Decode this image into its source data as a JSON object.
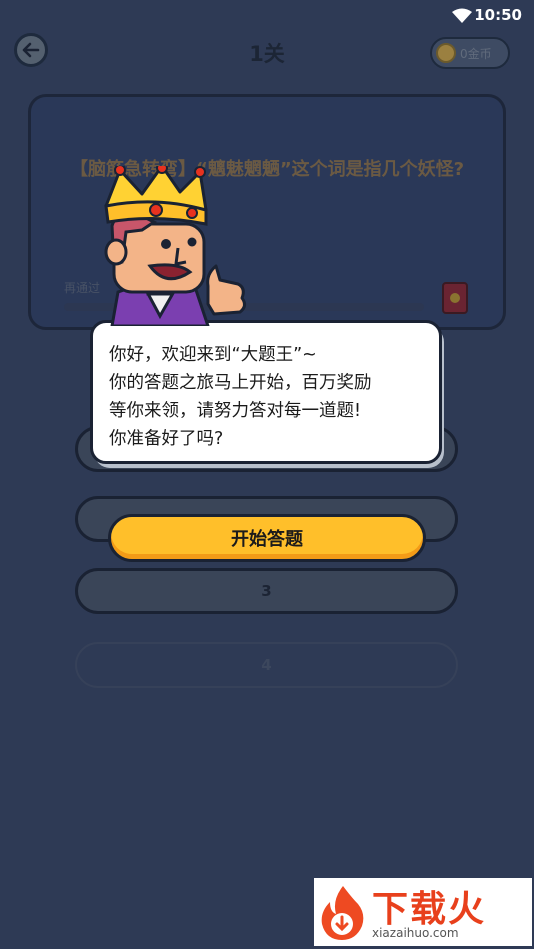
{
  "status_bar": {
    "time": "10:50",
    "wifi_icon": "wifi-icon"
  },
  "header": {
    "title": "1关",
    "coin_label": "0金币",
    "back_icon": "arrow-left-icon"
  },
  "question": {
    "text": "【脑筋急转弯】“魑魅魍魉”这个词是指几个妖怪?",
    "hint_label": "再通过"
  },
  "options": [
    "",
    "",
    "3",
    "4"
  ],
  "dialog": {
    "message": "你好，欢迎来到“大题王”~\n你的答题之旅马上开始，百万奖励\n等你来领，请努力答对每一道题!\n你准备好了吗?",
    "start_button": "开始答题"
  },
  "watermark": {
    "brand": "下载火",
    "domain": "xiazaihuo.com"
  },
  "colors": {
    "background": "#2e3a55",
    "accent": "#ffbf2a",
    "crown": "#ffd233",
    "shirt": "#7b3fb0"
  }
}
